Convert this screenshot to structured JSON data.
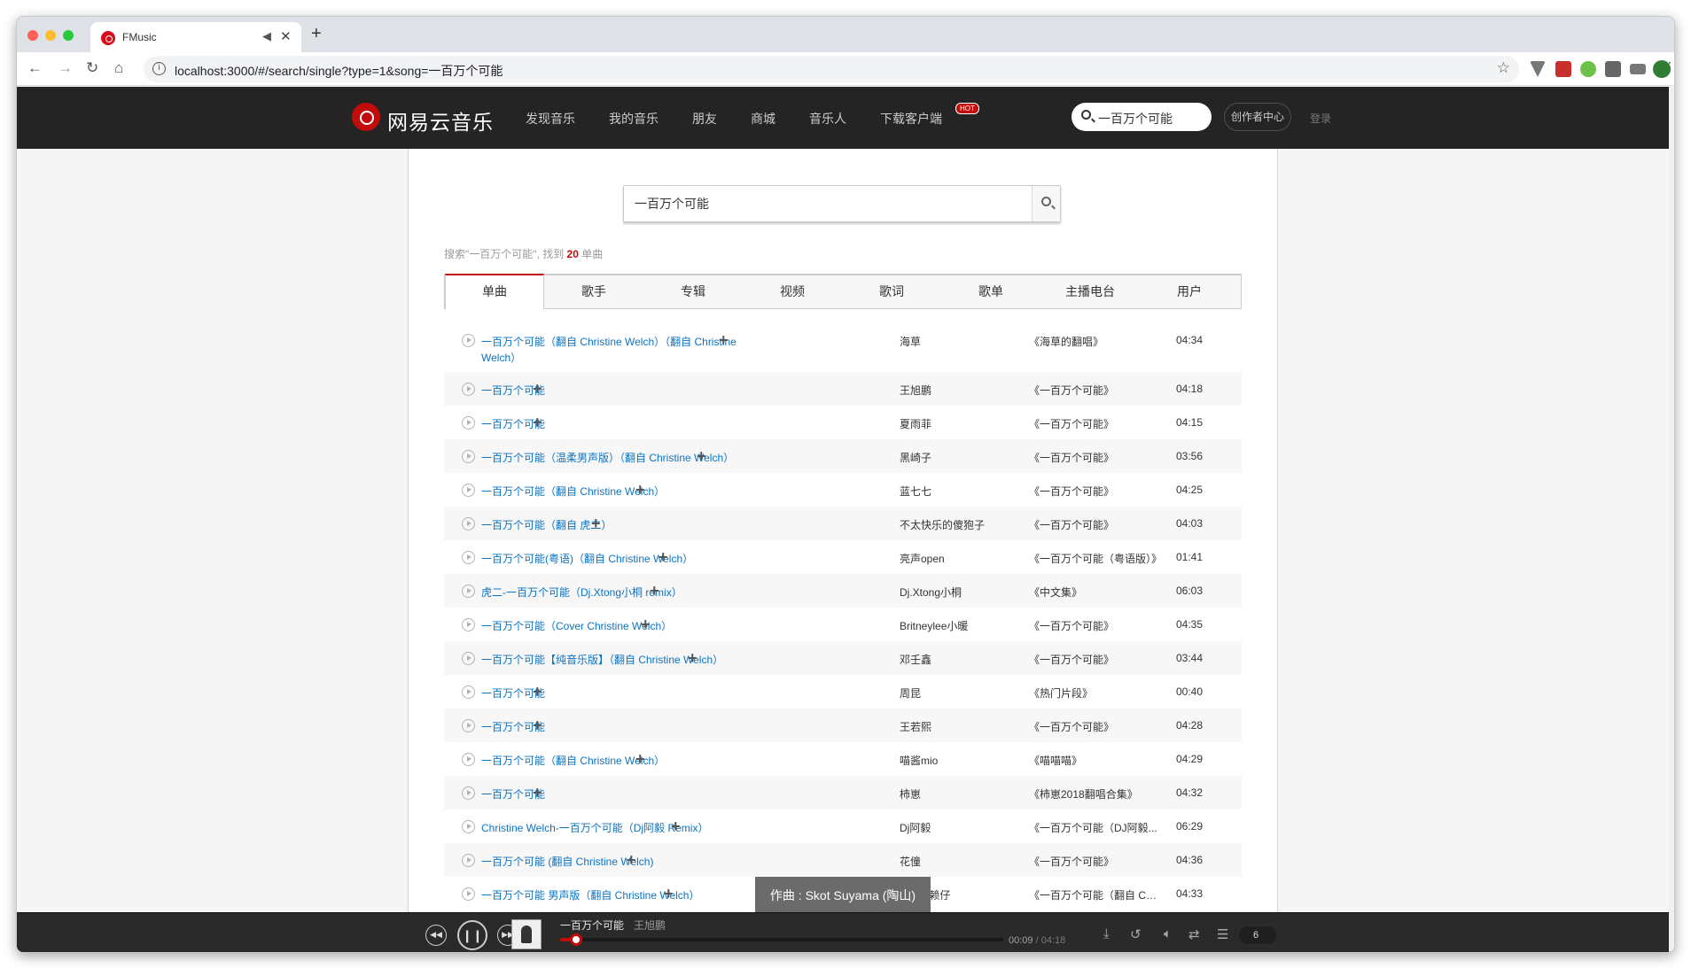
{
  "browser": {
    "tab_title": "FMusic",
    "url": "localhost:3000/#/search/single?type=1&song=一百万个可能"
  },
  "header": {
    "logo": "网易云音乐",
    "nav": [
      "发现音乐",
      "我的音乐",
      "朋友",
      "商城",
      "音乐人",
      "下载客户端"
    ],
    "hot_badge": "HOT",
    "search_value": "一百万个可能",
    "creator_center": "创作者中心",
    "login": "登录"
  },
  "search": {
    "query": "一百万个可能",
    "summary_prefix": "搜索\"一百万个可能\", 找到",
    "count": "20",
    "summary_suffix": "单曲",
    "tabs": [
      "单曲",
      "歌手",
      "专辑",
      "视频",
      "歌词",
      "歌单",
      "主播电台",
      "用户"
    ],
    "active_tab": "单曲"
  },
  "songs": [
    {
      "name": "一百万个可能（翻自 Christine Welch）（翻自 Christine Welch）",
      "artist": "海草",
      "album": "《海草的翻唱》",
      "duration": "04:34"
    },
    {
      "name": "一百万个可能",
      "artist": "王旭鹏",
      "album": "《一百万个可能》",
      "duration": "04:18"
    },
    {
      "name": "一百万个可能",
      "artist": "夏雨菲",
      "album": "《一百万个可能》",
      "duration": "04:15"
    },
    {
      "name": "一百万个可能（温柔男声版）（翻自 Christine Welch）",
      "artist": "黑崎子",
      "album": "《一百万个可能》",
      "duration": "03:56"
    },
    {
      "name": "一百万个可能（翻自 Christine Welch）",
      "artist": "蓝七七",
      "album": "《一百万个可能》",
      "duration": "04:25"
    },
    {
      "name": "一百万个可能（翻自 虎二）",
      "artist": "不太快乐的傻狍子",
      "album": "《一百万个可能》",
      "duration": "04:03"
    },
    {
      "name": "一百万个可能(粤语)（翻自 Christine Welch）",
      "artist": "亮声open",
      "album": "《一百万个可能（粤语版）》",
      "duration": "01:41"
    },
    {
      "name": "虎二-一百万个可能（Dj.Xtong小桐 remix）",
      "artist": "Dj.Xtong小桐",
      "album": "《中文集》",
      "duration": "06:03"
    },
    {
      "name": "一百万个可能（Cover Christine Welch）",
      "artist": "Britneylee小暖",
      "album": "《一百万个可能》",
      "duration": "04:35"
    },
    {
      "name": "一百万个可能【纯音乐版】（翻自 Christine Welch）",
      "artist": "邓壬鑫",
      "album": "《一百万个可能》",
      "duration": "03:44"
    },
    {
      "name": "一百万个可能",
      "artist": "周昆",
      "album": "《热门片段》",
      "duration": "00:40"
    },
    {
      "name": "一百万个可能",
      "artist": "王若熙",
      "album": "《一百万个可能》",
      "duration": "04:28"
    },
    {
      "name": "一百万个可能（翻自 Christine Welch）",
      "artist": "喵酱mio",
      "album": "《喵喵喵》",
      "duration": "04:29"
    },
    {
      "name": "一百万个可能",
      "artist": "柿崽",
      "album": "《柿崽2018翻唱合集》",
      "duration": "04:32"
    },
    {
      "name": "Christine Welch-一百万个可能（Dj阿毅 Remix）",
      "artist": "Dj阿毅",
      "album": "《一百万个可能（DJ阿毅...",
      "duration": "06:29"
    },
    {
      "name": "一百万个可能 (翻自 Christine Welch)",
      "artist": "花僮",
      "album": "《一百万个可能》",
      "duration": "04:36"
    },
    {
      "name": "一百万个可能 男声版（翻自 Christine Welch）",
      "artist": "Morris赖仔",
      "album": "《一百万个可能（翻自 Chr...",
      "duration": "04:33"
    }
  ],
  "tooltip": "作曲 : Skot Suyama (陶山)",
  "player": {
    "song": "一百万个可能",
    "singer": "王旭鹏",
    "current_time": "00:09",
    "total_time": "/ 04:18",
    "progress": 0.035,
    "playlist_count": "6"
  },
  "colors": {
    "accent": "#c20c0c",
    "link": "#0c73c2",
    "topbar": "#242424"
  }
}
